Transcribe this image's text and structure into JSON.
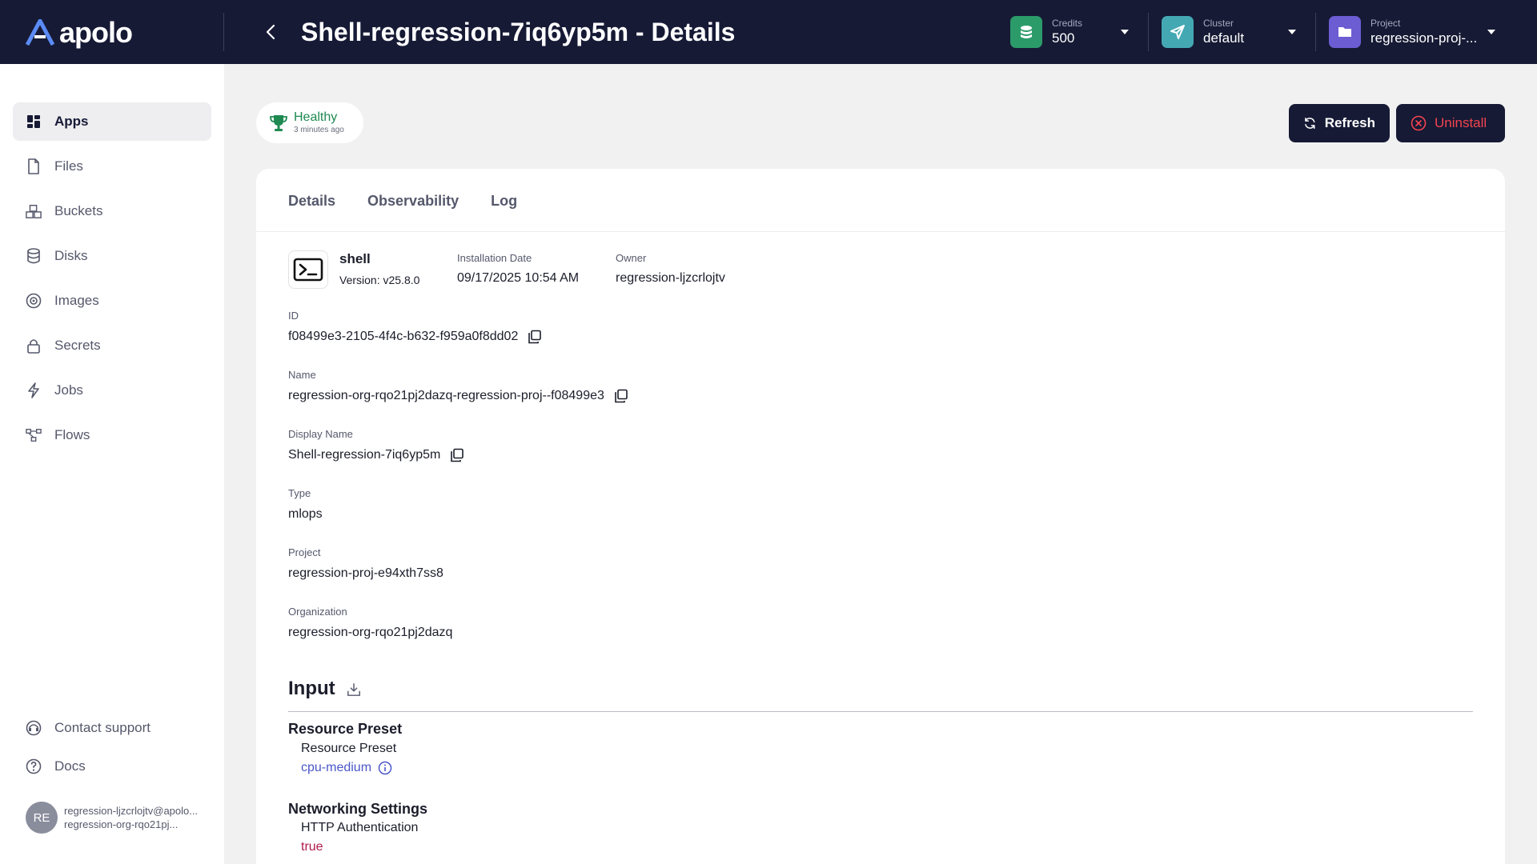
{
  "header": {
    "logo_text": "apolo",
    "title": "Shell-regression-7iq6yp5m - Details",
    "credits": {
      "label": "Credits",
      "value": "500"
    },
    "cluster": {
      "label": "Cluster",
      "value": "default"
    },
    "project": {
      "label": "Project",
      "value": "regression-proj-..."
    }
  },
  "sidebar": {
    "items": [
      {
        "label": "Apps",
        "icon": "apps-grid-icon"
      },
      {
        "label": "Files",
        "icon": "file-icon"
      },
      {
        "label": "Buckets",
        "icon": "buckets-icon"
      },
      {
        "label": "Disks",
        "icon": "database-icon"
      },
      {
        "label": "Images",
        "icon": "disc-icon"
      },
      {
        "label": "Secrets",
        "icon": "lock-icon"
      },
      {
        "label": "Jobs",
        "icon": "lightning-icon"
      },
      {
        "label": "Flows",
        "icon": "flow-icon"
      }
    ],
    "contact_support": "Contact support",
    "docs": "Docs",
    "user": {
      "initials": "RE",
      "email": "regression-ljzcrlojtv@apolo...",
      "org": "regression-org-rqo21pj..."
    }
  },
  "status": {
    "label": "Healthy",
    "time": "3 minutes ago"
  },
  "actions": {
    "refresh": "Refresh",
    "uninstall": "Uninstall"
  },
  "tabs": [
    "Details",
    "Observability",
    "Log"
  ],
  "app": {
    "name": "shell",
    "version": "Version: v25.8.0",
    "installation_date_label": "Installation Date",
    "installation_date": "09/17/2025 10:54 AM",
    "owner_label": "Owner",
    "owner": "regression-ljzcrlojtv"
  },
  "fields": {
    "id": {
      "label": "ID",
      "value": "f08499e3-2105-4f4c-b632-f959a0f8dd02"
    },
    "name": {
      "label": "Name",
      "value": "regression-org-rqo21pj2dazq-regression-proj--f08499e3"
    },
    "display_name": {
      "label": "Display Name",
      "value": "Shell-regression-7iq6yp5m"
    },
    "type": {
      "label": "Type",
      "value": "mlops"
    },
    "project": {
      "label": "Project",
      "value": "regression-proj-e94xth7ss8"
    },
    "organization": {
      "label": "Organization",
      "value": "regression-org-rqo21pj2dazq"
    }
  },
  "input": {
    "title": "Input",
    "resource_preset": {
      "title": "Resource Preset",
      "label": "Resource Preset",
      "value": "cpu-medium"
    },
    "networking": {
      "title": "Networking Settings",
      "label": "HTTP Authentication",
      "value": "true"
    }
  },
  "colors": {
    "topbar": "#161a35",
    "healthy": "#1e8a52",
    "uninstall": "#f4444f",
    "link": "#4a57c8",
    "true_value": "#b0194c"
  }
}
